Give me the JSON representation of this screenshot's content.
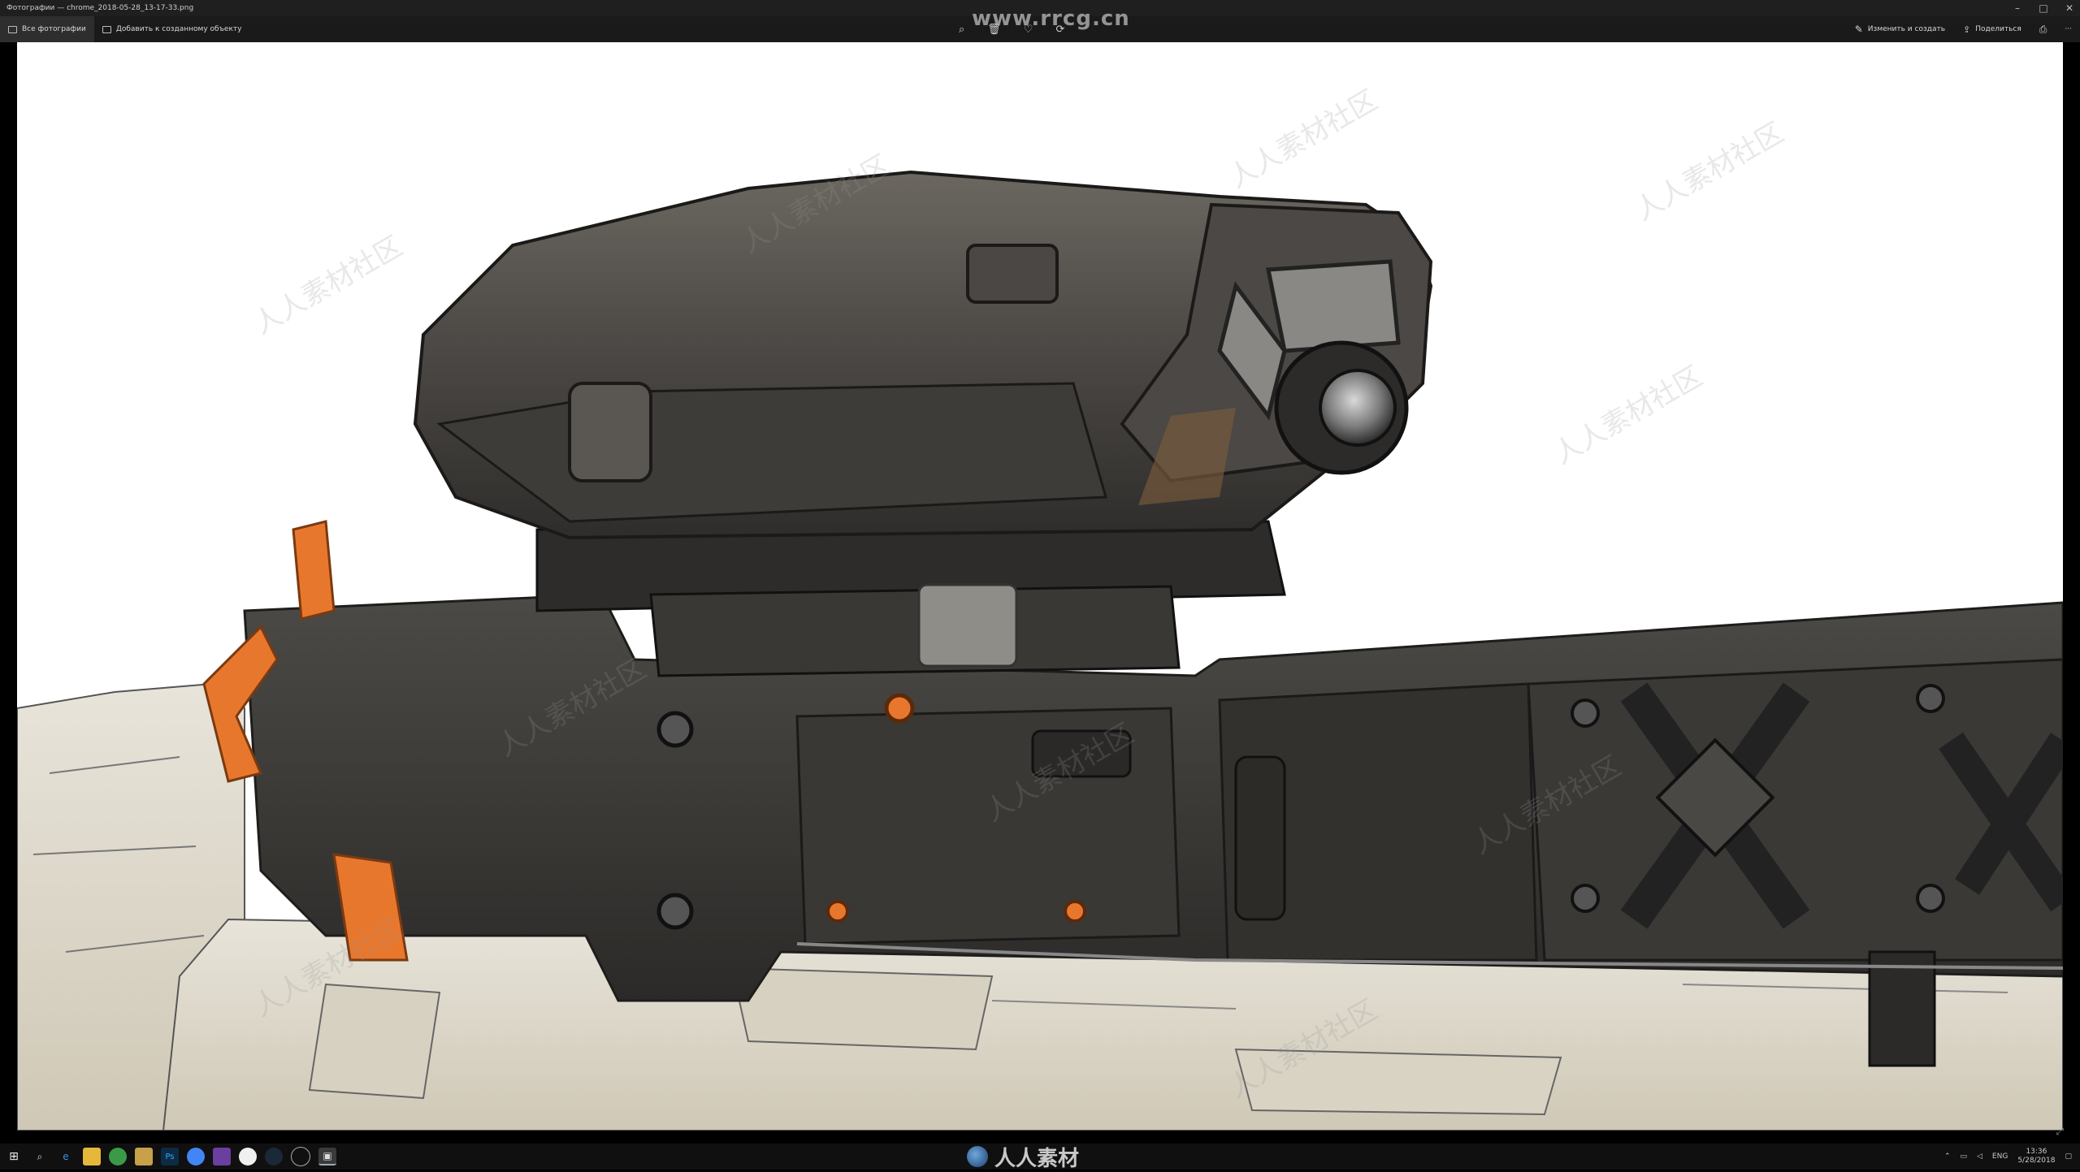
{
  "window": {
    "title": "Фотографии — chrome_2018-05-28_13-17-33.png",
    "controls": [
      "–",
      "□",
      "✕"
    ]
  },
  "toolbar": {
    "all_photos_label": "Все фотографии",
    "add_to_creation_label": "Добавить к созданному объекту",
    "center_icons": [
      "zoom-in-icon",
      "delete-icon",
      "favorite-icon",
      "rotate-icon"
    ],
    "edit_create_label": "Изменить и создать",
    "share_label": "Поделиться",
    "print_icon": "print-icon",
    "more_label": "···"
  },
  "watermarks": {
    "top": "www.rrcg.cn",
    "bottom": "人人素材",
    "tile": "人人素材社区"
  },
  "taskbar": {
    "start_icon": "windows-start-icon",
    "apps": [
      "search-icon",
      "edge-icon",
      "file-explorer-icon",
      "chrome-icon",
      "folder-icon",
      "photoshop-icon",
      "chrome-alt-icon",
      "visual-studio-icon",
      "fusion-icon",
      "steam-icon",
      "clock-app-icon",
      "photos-icon"
    ],
    "tray_language": "ENG",
    "clock_time": "13:36",
    "clock_date": "5/28/2018"
  },
  "colors": {
    "accent_orange": "#e8772e",
    "dark_body": "#3d3b38",
    "stock_beige": "#dcd6c8"
  }
}
